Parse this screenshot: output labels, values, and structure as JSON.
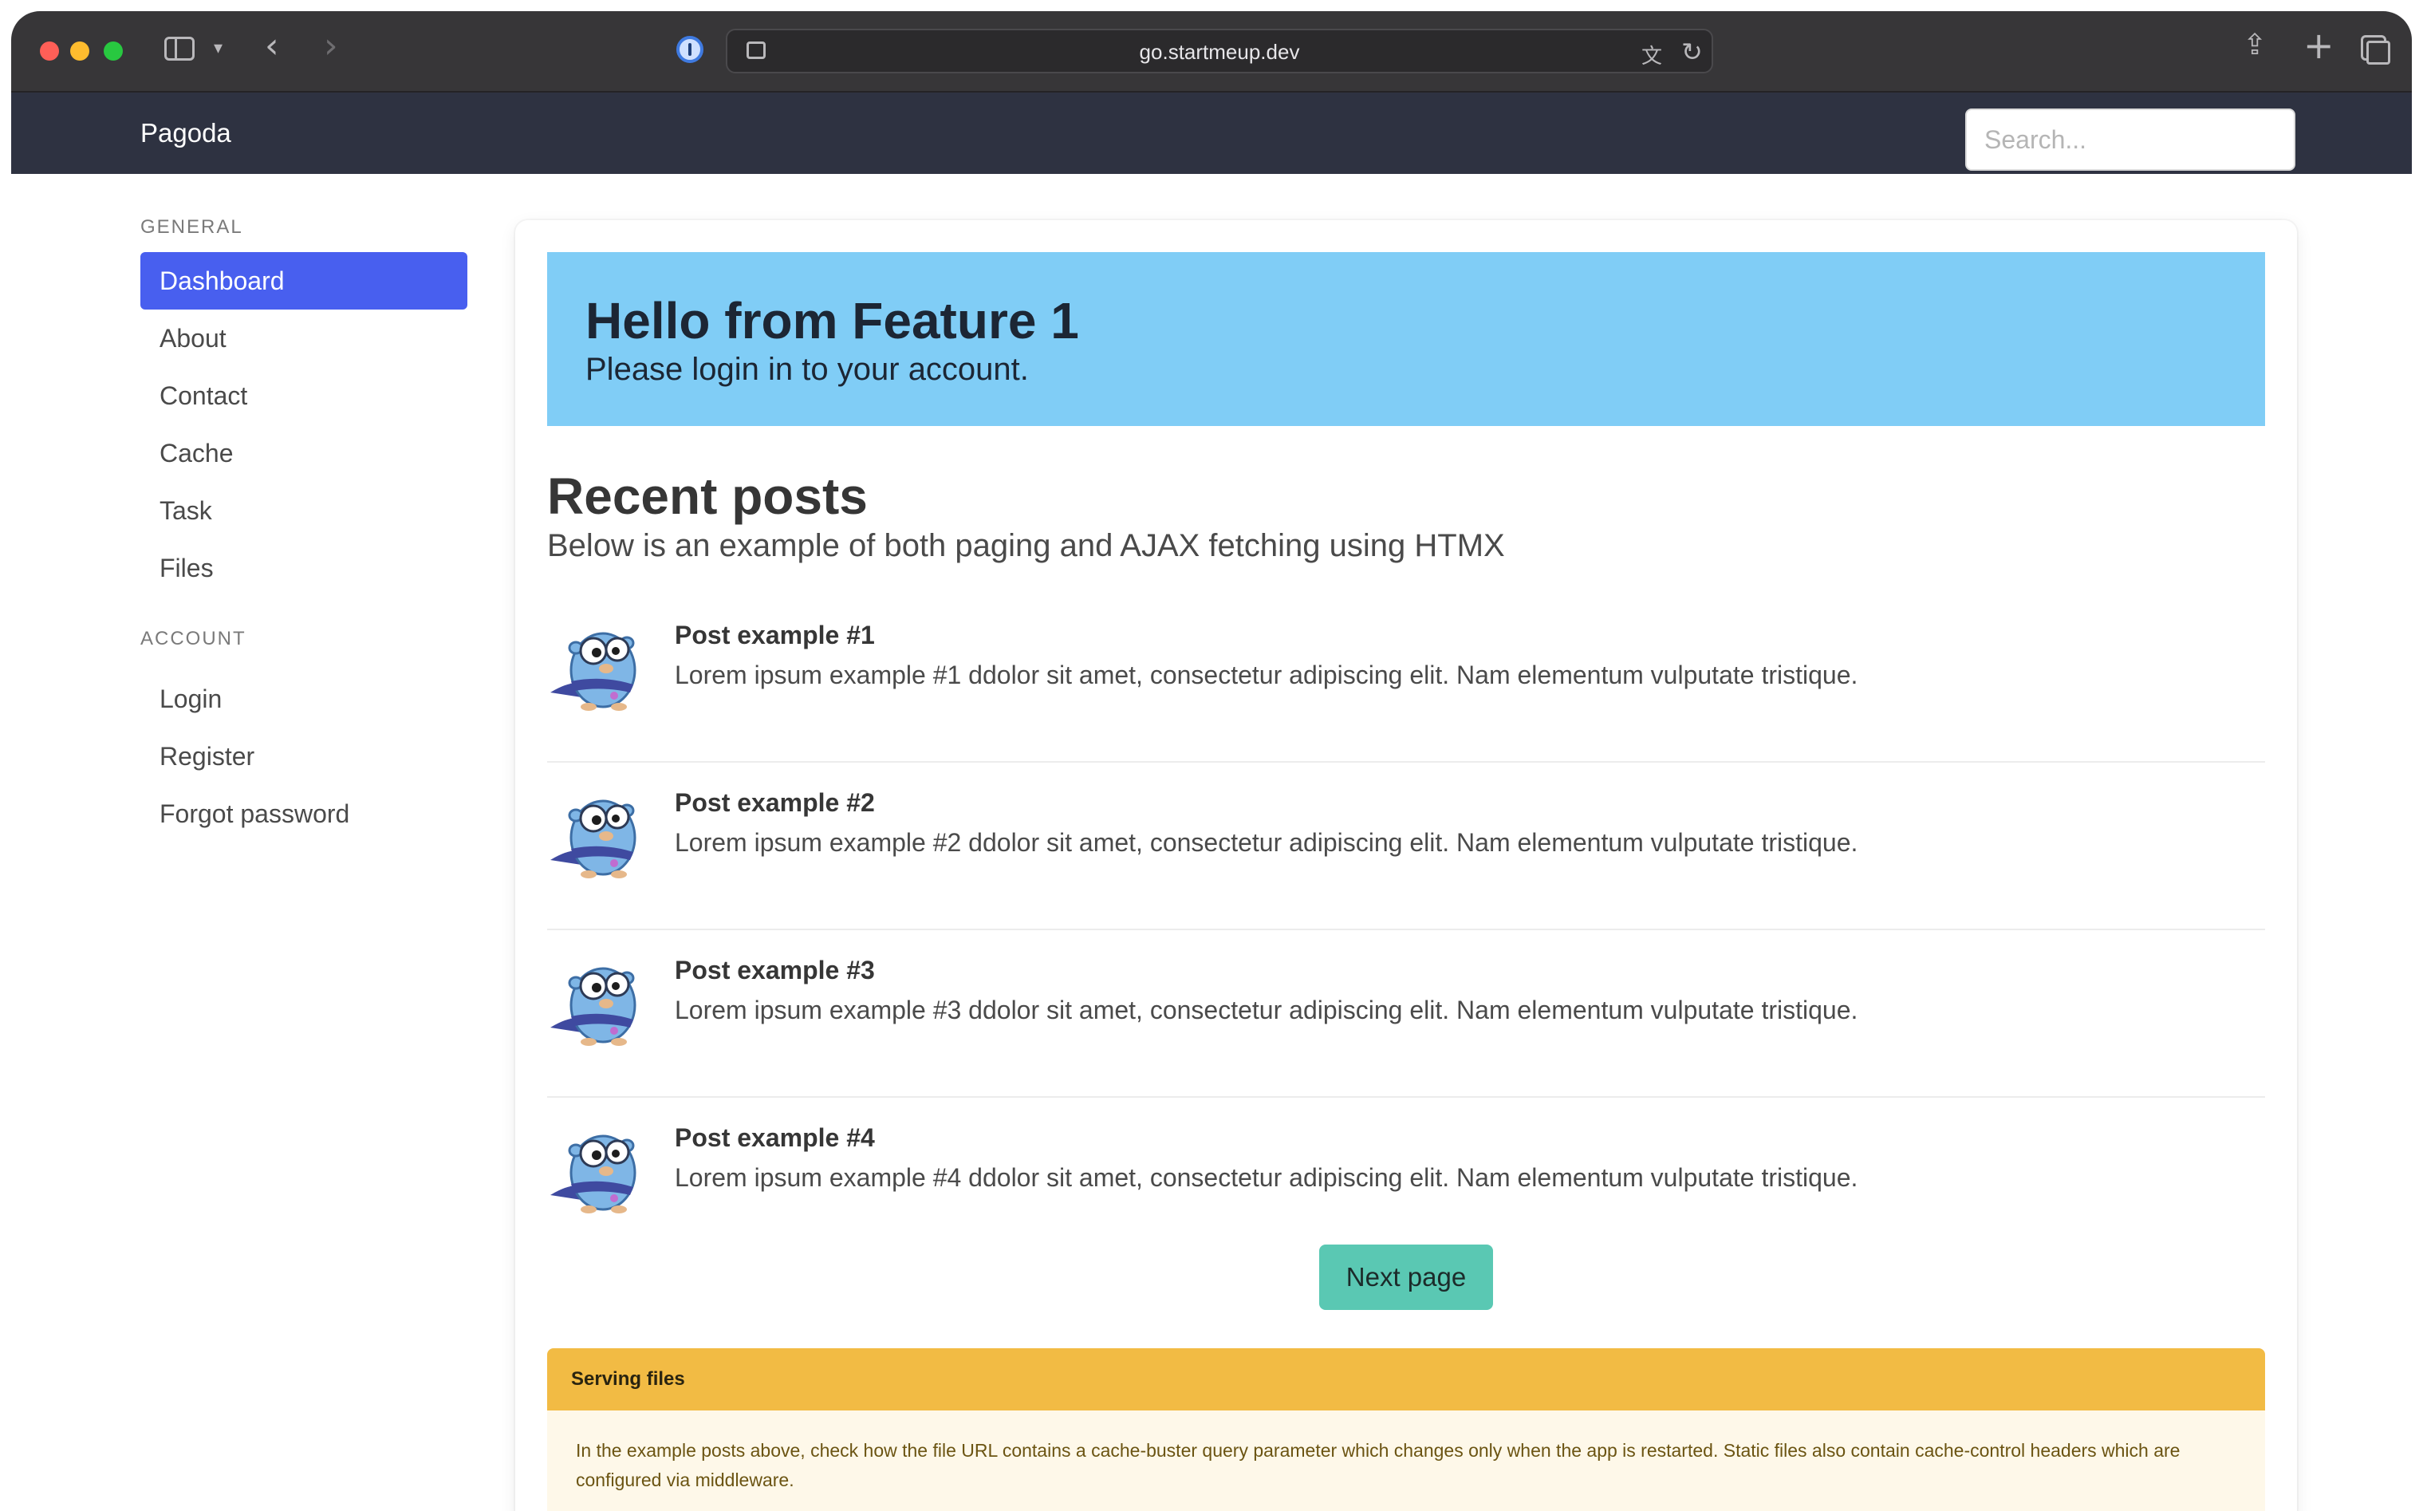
{
  "browser": {
    "url": "go.startmeup.dev"
  },
  "navbar": {
    "brand": "Pagoda",
    "search_placeholder": "Search..."
  },
  "sidebar": {
    "general_label": "GENERAL",
    "general_items": [
      {
        "label": "Dashboard",
        "active": true
      },
      {
        "label": "About"
      },
      {
        "label": "Contact"
      },
      {
        "label": "Cache"
      },
      {
        "label": "Task"
      },
      {
        "label": "Files"
      }
    ],
    "account_label": "ACCOUNT",
    "account_items": [
      {
        "label": "Login"
      },
      {
        "label": "Register"
      },
      {
        "label": "Forgot password"
      }
    ]
  },
  "hero": {
    "title": "Hello from Feature 1",
    "subtitle": "Please login in to your account."
  },
  "recent": {
    "title": "Recent posts",
    "subtitle": "Below is an example of both paging and AJAX fetching using HTMX"
  },
  "posts": [
    {
      "title": "Post example #1",
      "body": "Lorem ipsum example #1 ddolor sit amet, consectetur adipiscing elit. Nam elementum vulputate tristique."
    },
    {
      "title": "Post example #2",
      "body": "Lorem ipsum example #2 ddolor sit amet, consectetur adipiscing elit. Nam elementum vulputate tristique."
    },
    {
      "title": "Post example #3",
      "body": "Lorem ipsum example #3 ddolor sit amet, consectetur adipiscing elit. Nam elementum vulputate tristique."
    },
    {
      "title": "Post example #4",
      "body": "Lorem ipsum example #4 ddolor sit amet, consectetur adipiscing elit. Nam elementum vulputate tristique."
    }
  ],
  "pagination": {
    "next_label": "Next page"
  },
  "notice": {
    "header": "Serving files",
    "body": "In the example posts above, check how the file URL contains a cache-buster query parameter which changes only when the app is restarted. Static files also contain cache-control headers which are configured via middleware."
  },
  "colors": {
    "navbar": "#2e3241",
    "active_menu": "#485fef",
    "hero": "#80cdf6",
    "button": "#5ac8b3",
    "warning_header": "#f2bb44",
    "warning_body": "#fef8e9"
  },
  "icons": [
    "sidebar-icon",
    "chevron-down-icon",
    "back-icon",
    "forward-icon",
    "password-manager-icon",
    "site-settings-icon",
    "translate-icon",
    "reload-icon",
    "share-icon",
    "new-tab-icon",
    "tab-overview-icon",
    "gopher-icon"
  ]
}
